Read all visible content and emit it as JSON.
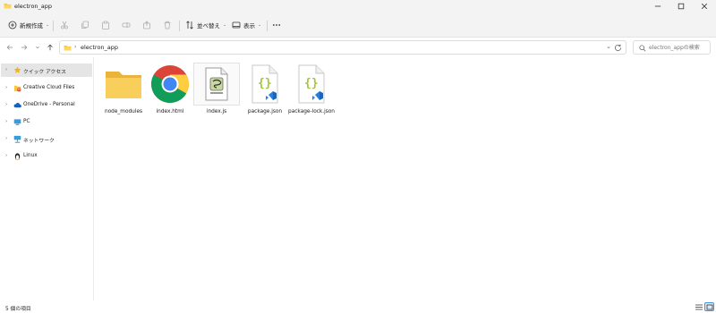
{
  "window": {
    "title": "electron_app"
  },
  "toolbar": {
    "new_label": "新規作成",
    "sort_label": "並べ替え",
    "view_label": "表示"
  },
  "address": {
    "crumb": "electron_app"
  },
  "search": {
    "placeholder": "electron_appの検索"
  },
  "sidebar": {
    "items": [
      {
        "label": "クイック アクセス",
        "icon": "star-icon"
      },
      {
        "label": "Creative Cloud Files",
        "icon": "creative-cloud-icon"
      },
      {
        "label": "OneDrive - Personal",
        "icon": "cloud-icon"
      },
      {
        "label": "PC",
        "icon": "pc-icon"
      },
      {
        "label": "ネットワーク",
        "icon": "network-icon"
      },
      {
        "label": "Linux",
        "icon": "linux-icon"
      }
    ]
  },
  "files": [
    {
      "name": "node_modules",
      "icon": "folder-icon"
    },
    {
      "name": "index.html",
      "icon": "chrome-icon"
    },
    {
      "name": "index.js",
      "icon": "js-file-icon"
    },
    {
      "name": "package.json",
      "icon": "json-file-icon"
    },
    {
      "name": "package-lock.json",
      "icon": "json-file-icon"
    }
  ],
  "status": {
    "count": "5 個の項目"
  },
  "colors": {
    "accent": "#0067c0",
    "folder": "#f6c744",
    "json_brace": "#a4c639",
    "vscode_blue": "#2b7fd8"
  }
}
